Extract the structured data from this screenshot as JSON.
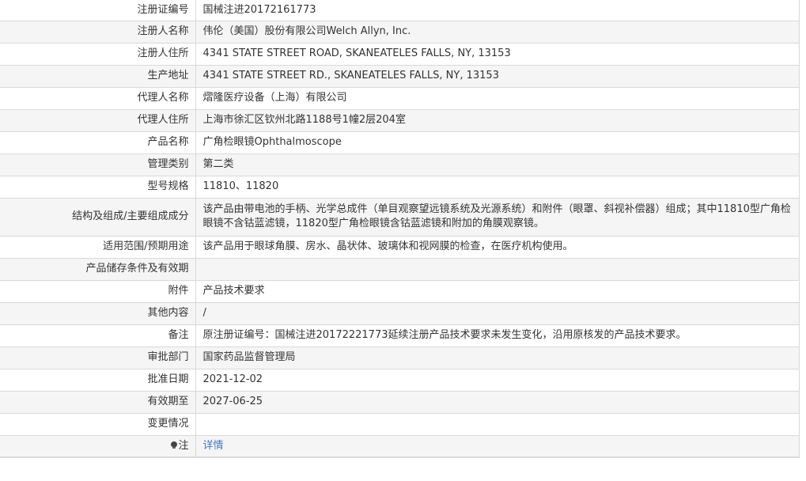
{
  "rows": [
    {
      "label": "注册证编号",
      "value": "国械注进20172161773"
    },
    {
      "label": "注册人名称",
      "value": "伟伦（美国）股份有限公司Welch Allyn, Inc."
    },
    {
      "label": "注册人住所",
      "value": "4341 STATE STREET ROAD, SKANEATELES FALLS, NY, 13153"
    },
    {
      "label": "生产地址",
      "value": "4341 STATE STREET RD., SKANEATELES FALLS, NY, 13153"
    },
    {
      "label": "代理人名称",
      "value": "熠隆医疗设备（上海）有限公司"
    },
    {
      "label": "代理人住所",
      "value": "上海市徐汇区钦州北路1188号1幢2层204室"
    },
    {
      "label": "产品名称",
      "value": "广角检眼镜Ophthalmoscope"
    },
    {
      "label": "管理类别",
      "value": "第二类"
    },
    {
      "label": "型号规格",
      "value": "11810、11820"
    },
    {
      "label": "结构及组成/主要组成成分",
      "value": "该产品由带电池的手柄、光学总成件（单目观察望远镜系统及光源系统）和附件（眼罩、斜视补偿器）组成；其中11810型广角检眼镜不含钴蓝滤镜，11820型广角检眼镜含钴蓝滤镜和附加的角膜观察镜。"
    },
    {
      "label": "适用范围/预期用途",
      "value": "该产品用于眼球角膜、房水、晶状体、玻璃体和视网膜的检查，在医疗机构使用。"
    },
    {
      "label": "产品储存条件及有效期",
      "value": ""
    },
    {
      "label": "附件",
      "value": "产品技术要求"
    },
    {
      "label": "其他内容",
      "value": "/"
    },
    {
      "label": "备注",
      "value": "原注册证编号：国械注进20172221773延续注册产品技术要求未发生变化，沿用原核发的产品技术要求。"
    },
    {
      "label": "审批部门",
      "value": "国家药品监督管理局"
    },
    {
      "label": "批准日期",
      "value": "2021-12-02"
    },
    {
      "label": "有效期至",
      "value": "2027-06-25"
    },
    {
      "label": "变更情况",
      "value": ""
    }
  ],
  "note_row": {
    "icon": "lightbulb-icon",
    "label": "注",
    "link_text": "详情",
    "link_color": "#3a7bc8"
  },
  "colors": {
    "border": "#d9d9d9",
    "stripe": "#f5f5f5",
    "text": "#333333"
  }
}
